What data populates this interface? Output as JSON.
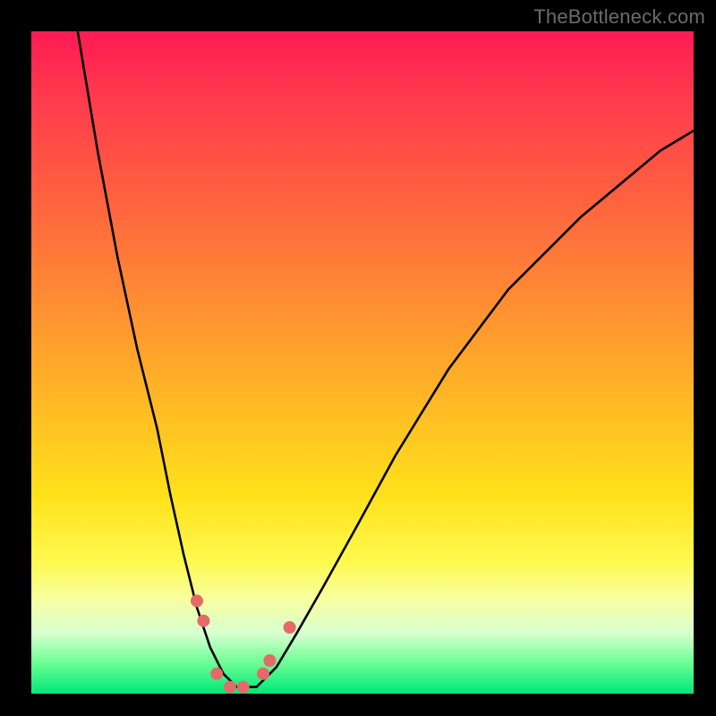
{
  "watermark": "TheBottleneck.com",
  "chart_data": {
    "type": "line",
    "title": "",
    "xlabel": "",
    "ylabel": "",
    "xlim": [
      0,
      100
    ],
    "ylim": [
      0,
      100
    ],
    "grid": false,
    "series": [
      {
        "name": "bottleneck-curve",
        "x": [
          7,
          10,
          13,
          16,
          19,
          21,
          23,
          25,
          27,
          29,
          31,
          34,
          37,
          40,
          44,
          49,
          55,
          63,
          72,
          83,
          95,
          100
        ],
        "values": [
          100,
          82,
          66,
          52,
          40,
          30,
          21,
          13,
          7,
          3,
          1,
          1,
          4,
          9,
          16,
          25,
          36,
          49,
          61,
          72,
          82,
          85
        ]
      }
    ],
    "markers": [
      {
        "name": "dot-left-a",
        "x": 25,
        "y": 14
      },
      {
        "name": "dot-left-b",
        "x": 26,
        "y": 11
      },
      {
        "name": "dot-mid-a",
        "x": 28,
        "y": 3
      },
      {
        "name": "dot-mid-b",
        "x": 30,
        "y": 1
      },
      {
        "name": "dot-mid-c",
        "x": 32,
        "y": 1
      },
      {
        "name": "dot-right-a",
        "x": 35,
        "y": 3
      },
      {
        "name": "dot-right-b",
        "x": 36,
        "y": 5
      },
      {
        "name": "dot-right-c",
        "x": 39,
        "y": 10
      }
    ],
    "colors": {
      "curve": "#000000",
      "markers": "#e46a6a",
      "gradient_top": "#ff1a55",
      "gradient_mid": "#ffe11a",
      "gradient_bot": "#00e878"
    }
  }
}
